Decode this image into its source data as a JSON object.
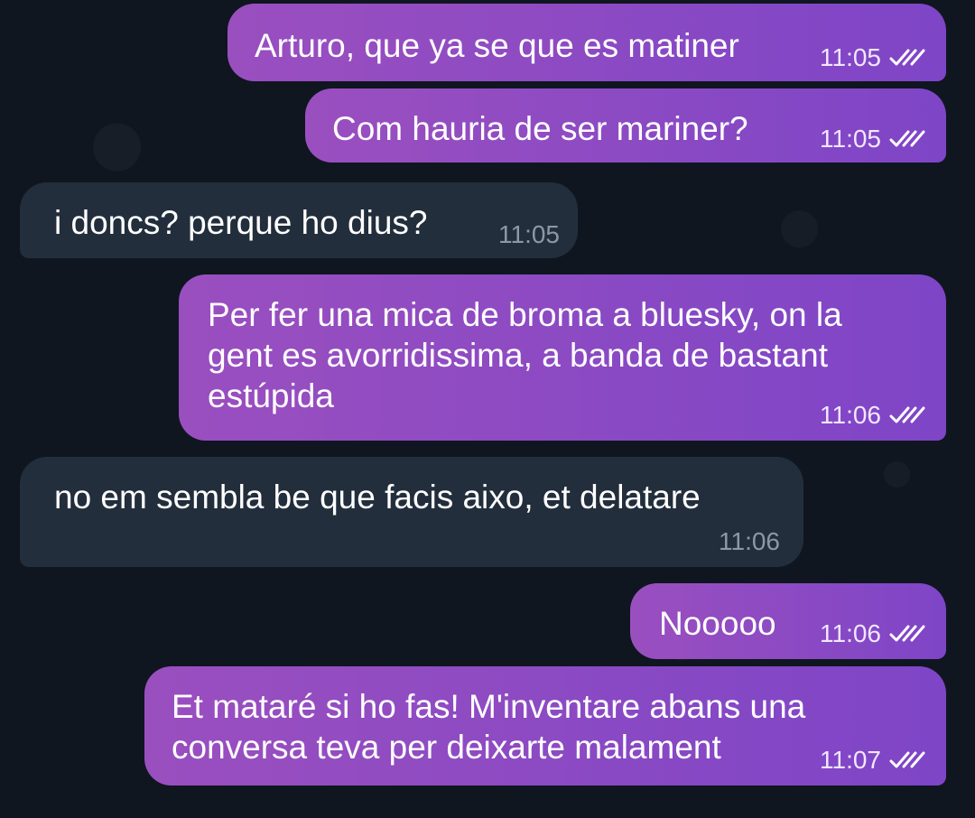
{
  "chat": {
    "messages": [
      {
        "text": "Arturo, que ya se que es matiner",
        "time": "11:05",
        "direction": "out",
        "read": true
      },
      {
        "text": "Com hauria de ser mariner?",
        "time": "11:05",
        "direction": "out",
        "read": true
      },
      {
        "text": "i doncs? perque ho dius?",
        "time": "11:05",
        "direction": "in"
      },
      {
        "text": "Per fer una mica de broma a bluesky, on la\ngent es avorridissima, a banda de bastant\nestúpida",
        "time": "11:06",
        "direction": "out",
        "read": true
      },
      {
        "text": "no em sembla be que facis aixo, et delatare",
        "time": "11:06",
        "direction": "in"
      },
      {
        "text": "Nooooo",
        "time": "11:06",
        "direction": "out",
        "read": true
      },
      {
        "text": "Et mataré si ho fas! M'inventare abans una\nconversa teva per deixarte malament",
        "time": "11:07",
        "direction": "out",
        "read": true
      }
    ]
  },
  "colors": {
    "outgoing_start": "#9a4fbf",
    "outgoing_end": "#7e45c7",
    "incoming": "#232e3c",
    "background": "#0f1620"
  },
  "icons": {
    "read_receipt": "double-check-icon"
  }
}
